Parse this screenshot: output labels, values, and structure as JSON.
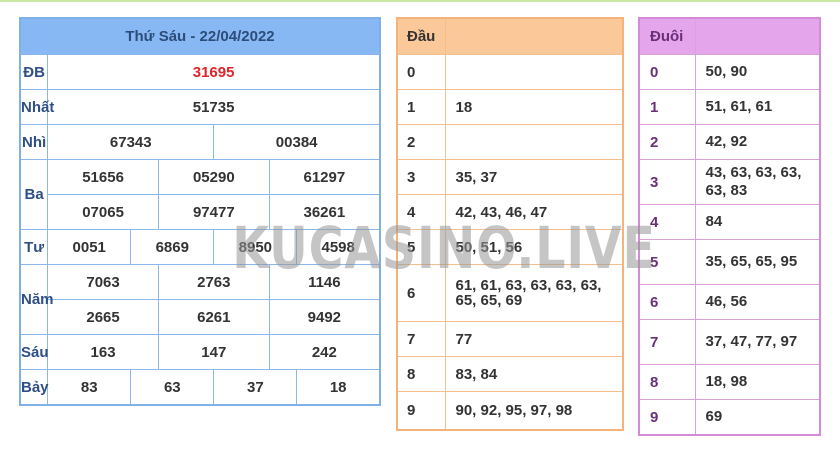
{
  "results": {
    "header": "Thứ Sáu - 22/04/2022",
    "rows": {
      "db": {
        "label": "ĐB",
        "values": [
          "31695"
        ]
      },
      "nhat": {
        "label": "Nhất",
        "values": [
          "51735"
        ]
      },
      "nhi": {
        "label": "Nhì",
        "values": [
          "67343",
          "00384"
        ]
      },
      "ba": {
        "label": "Ba",
        "values": [
          "51656",
          "05290",
          "61297",
          "07065",
          "97477",
          "36261"
        ]
      },
      "tu": {
        "label": "Tư",
        "values": [
          "0051",
          "6869",
          "8950",
          "4598"
        ]
      },
      "nam": {
        "label": "Năm",
        "values": [
          "7063",
          "2763",
          "1146",
          "2665",
          "6261",
          "9492"
        ]
      },
      "sau": {
        "label": "Sáu",
        "values": [
          "163",
          "147",
          "242"
        ]
      },
      "bay": {
        "label": "Bảy",
        "values": [
          "83",
          "63",
          "37",
          "18"
        ]
      }
    }
  },
  "dau": {
    "header": "Đầu",
    "rows": [
      {
        "k": "0",
        "v": ""
      },
      {
        "k": "1",
        "v": "18"
      },
      {
        "k": "2",
        "v": ""
      },
      {
        "k": "3",
        "v": "35, 37"
      },
      {
        "k": "4",
        "v": "42, 43, 46, 47"
      },
      {
        "k": "5",
        "v": "50, 51, 56"
      },
      {
        "k": "6",
        "v": "61, 61, 63, 63, 63, 63, 65, 65, 69"
      },
      {
        "k": "7",
        "v": "77"
      },
      {
        "k": "8",
        "v": "83, 84"
      },
      {
        "k": "9",
        "v": "90, 92, 95, 97, 98"
      }
    ]
  },
  "duoi": {
    "header": "Đuôi",
    "rows": [
      {
        "k": "0",
        "v": "50, 90"
      },
      {
        "k": "1",
        "v": "51, 61, 61"
      },
      {
        "k": "2",
        "v": "42, 92"
      },
      {
        "k": "3",
        "v": "43, 63, 63, 63, 63, 83"
      },
      {
        "k": "4",
        "v": "84"
      },
      {
        "k": "5",
        "v": "35, 65, 65, 95"
      },
      {
        "k": "6",
        "v": "46, 56"
      },
      {
        "k": "7",
        "v": "37, 47, 77, 97"
      },
      {
        "k": "8",
        "v": "18, 98"
      },
      {
        "k": "9",
        "v": "69"
      }
    ]
  },
  "watermark": "KUCASINO.LIVE",
  "colors": {
    "results_header": "#88b8f4",
    "dau_header": "#fbc89a",
    "duoi_header": "#e4a5ea",
    "special_prize": "#e0242a"
  }
}
